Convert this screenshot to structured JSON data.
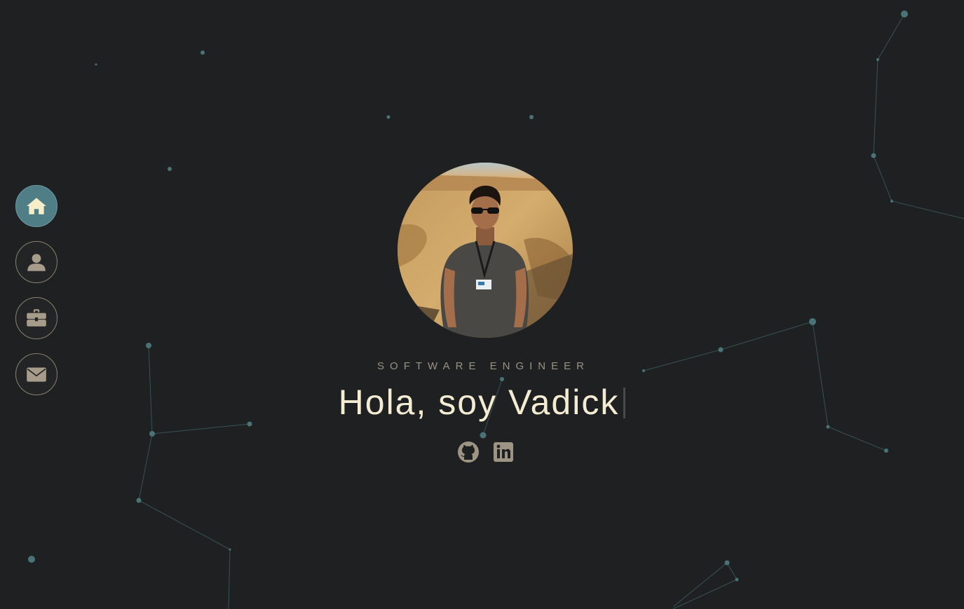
{
  "nav": {
    "items": [
      {
        "icon": "home-icon",
        "active": true
      },
      {
        "icon": "user-icon",
        "active": false
      },
      {
        "icon": "briefcase-icon",
        "active": false
      },
      {
        "icon": "envelope-icon",
        "active": false
      }
    ]
  },
  "hero": {
    "subtitle": "SOFTWARE ENGINEER",
    "headline": "Hola, soy Vadick",
    "photo_icon": "profile-photo"
  },
  "socials": [
    {
      "icon": "github-icon"
    },
    {
      "icon": "linkedin-icon"
    }
  ],
  "colors": {
    "background": "#1f2022",
    "accent": "#4f7e87",
    "text": "#f3ecd2",
    "muted": "#9b9382",
    "constellation": "#4a7378"
  }
}
